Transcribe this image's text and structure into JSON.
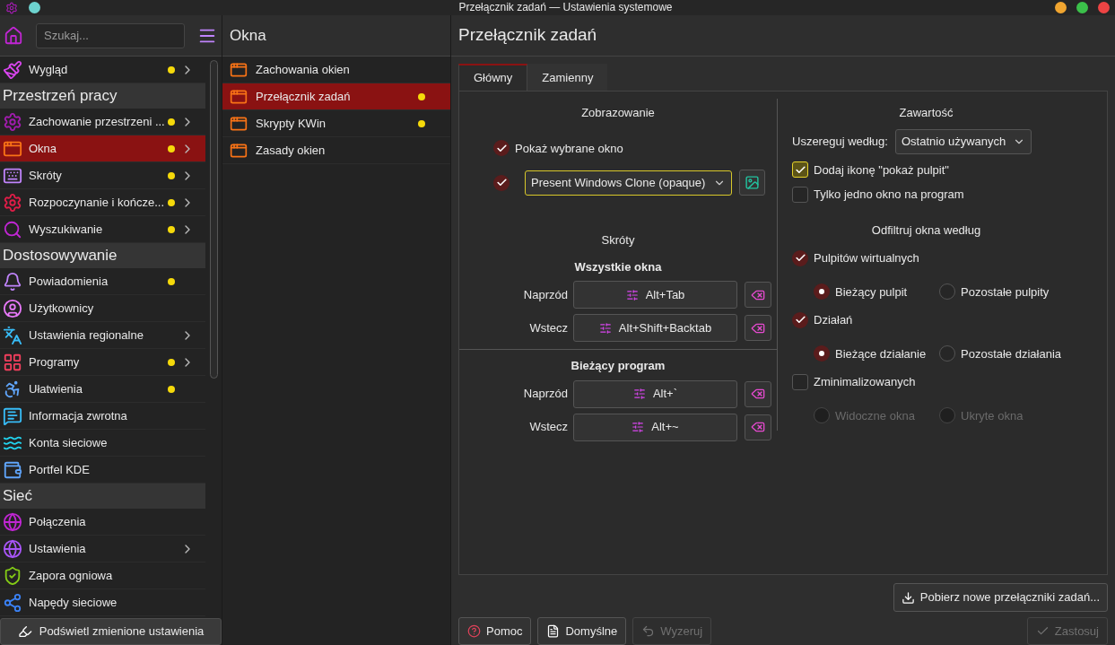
{
  "window": {
    "title": "Przełącznik zadań — Ustawienia systemowe"
  },
  "sidebar": {
    "search": {
      "placeholder": "Szukaj..."
    },
    "items": [
      {
        "kind": "item",
        "label": "Wygląd",
        "changed": true,
        "has_children": true,
        "selected": false
      },
      {
        "kind": "section",
        "label": "Przestrzeń pracy"
      },
      {
        "kind": "item",
        "label": "Zachowanie przestrzeni ...",
        "changed": true,
        "has_children": true,
        "selected": false
      },
      {
        "kind": "item",
        "label": "Okna",
        "changed": true,
        "has_children": true,
        "selected": true
      },
      {
        "kind": "item",
        "label": "Skróty",
        "changed": true,
        "has_children": true,
        "selected": false
      },
      {
        "kind": "item",
        "label": "Rozpoczynanie i kończe...",
        "changed": true,
        "has_children": true,
        "selected": false
      },
      {
        "kind": "item",
        "label": "Wyszukiwanie",
        "changed": true,
        "has_children": true,
        "selected": false
      },
      {
        "kind": "section",
        "label": "Dostosowywanie"
      },
      {
        "kind": "item",
        "label": "Powiadomienia",
        "changed": true,
        "has_children": false,
        "selected": false
      },
      {
        "kind": "item",
        "label": "Użytkownicy",
        "changed": false,
        "has_children": false,
        "selected": false
      },
      {
        "kind": "item",
        "label": "Ustawienia regionalne",
        "changed": false,
        "has_children": true,
        "selected": false
      },
      {
        "kind": "item",
        "label": "Programy",
        "changed": true,
        "has_children": true,
        "selected": false
      },
      {
        "kind": "item",
        "label": "Ułatwienia",
        "changed": true,
        "has_children": false,
        "selected": false
      },
      {
        "kind": "item",
        "label": "Informacja zwrotna",
        "changed": false,
        "has_children": false,
        "selected": false
      },
      {
        "kind": "item",
        "label": "Konta sieciowe",
        "changed": false,
        "has_children": false,
        "selected": false
      },
      {
        "kind": "item",
        "label": "Portfel KDE",
        "changed": false,
        "has_children": false,
        "selected": false
      },
      {
        "kind": "section",
        "label": "Sieć"
      },
      {
        "kind": "item",
        "label": "Połączenia",
        "changed": false,
        "has_children": false,
        "selected": false
      },
      {
        "kind": "item",
        "label": "Ustawienia",
        "changed": false,
        "has_children": true,
        "selected": false
      },
      {
        "kind": "item",
        "label": "Zapora ogniowa",
        "changed": false,
        "has_children": false,
        "selected": false
      },
      {
        "kind": "item",
        "label": "Napędy sieciowe",
        "changed": false,
        "has_children": false,
        "selected": false
      }
    ],
    "footer_button": "Podświetl zmienione ustawienia"
  },
  "subpanel": {
    "title": "Okna",
    "items": [
      {
        "label": "Zachowania okien",
        "changed": false,
        "selected": false
      },
      {
        "label": "Przełącznik zadań",
        "changed": true,
        "selected": true
      },
      {
        "label": "Skrypty KWin",
        "changed": true,
        "selected": false
      },
      {
        "label": "Zasady okien",
        "changed": false,
        "selected": false
      }
    ]
  },
  "page": {
    "title": "Przełącznik zadań",
    "tabs": [
      {
        "label": "Główny",
        "selected": true
      },
      {
        "label": "Zamienny",
        "selected": false
      }
    ],
    "visualization": {
      "heading": "Zobrazowanie",
      "show_selected": {
        "label": "Pokaż wybrane okno",
        "checked": true
      },
      "effect": {
        "checked": true,
        "value": "Present Windows Clone (opaque)",
        "focused": true
      }
    },
    "shortcuts": {
      "heading": "Skróty",
      "groups": [
        {
          "title": "Wszystkie okna",
          "rows": [
            {
              "label": "Naprzód",
              "shortcut": "Alt+Tab"
            },
            {
              "label": "Wstecz",
              "shortcut": "Alt+Shift+Backtab"
            }
          ]
        },
        {
          "title": "Bieżący program",
          "rows": [
            {
              "label": "Naprzód",
              "shortcut": "Alt+`"
            },
            {
              "label": "Wstecz",
              "shortcut": "Alt+~"
            }
          ]
        }
      ]
    },
    "content": {
      "heading": "Zawartość",
      "sort_label": "Uszereguj według:",
      "sort_value": "Ostatnio używanych",
      "options": [
        {
          "label": "Dodaj ikonę \"pokaż pulpit\"",
          "checked": true,
          "focused": true
        },
        {
          "label": "Tylko jedno okno na program",
          "checked": false,
          "focused": false
        }
      ],
      "filter_heading": "Odfiltruj okna według",
      "filters": [
        {
          "label": "Pulpitów wirtualnych",
          "checked": true,
          "choices": [
            {
              "label": "Bieżący pulpit",
              "selected": true
            },
            {
              "label": "Pozostałe pulpity",
              "selected": false
            }
          ]
        },
        {
          "label": "Działań",
          "checked": true,
          "choices": [
            {
              "label": "Bieżące działanie",
              "selected": true
            },
            {
              "label": "Pozostałe działania",
              "selected": false
            }
          ]
        },
        {
          "label": "Zminimalizowanych",
          "checked": false,
          "choices": [
            {
              "label": "Widoczne okna",
              "selected": false
            },
            {
              "label": "Ukryte okna",
              "selected": false
            }
          ]
        }
      ]
    },
    "get_new_button": "Pobierz nowe przełączniki zadań...",
    "buttons": [
      {
        "kind": "help",
        "label": "Pomoc",
        "disabled": false
      },
      {
        "kind": "defaults",
        "label": "Domyślne",
        "disabled": false
      },
      {
        "kind": "reset",
        "label": "Wyzeruj",
        "disabled": true
      },
      {
        "kind": "apply",
        "label": "Zastosuj",
        "disabled": true
      }
    ]
  }
}
